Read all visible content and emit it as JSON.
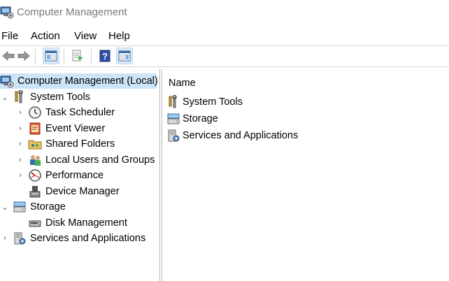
{
  "window": {
    "title": "Computer Management"
  },
  "menu": [
    "File",
    "Action",
    "View",
    "Help"
  ],
  "toolbar": {
    "buttons": [
      "back",
      "forward",
      "show-hide-console-tree",
      "export-list",
      "help",
      "show-hide-action-pane"
    ]
  },
  "tree": {
    "root": "Computer Management (Local)",
    "system_tools": "System Tools",
    "task_scheduler": "Task Scheduler",
    "event_viewer": "Event Viewer",
    "shared_folders": "Shared Folders",
    "local_users": "Local Users and Groups",
    "performance": "Performance",
    "device_manager": "Device Manager",
    "storage": "Storage",
    "disk_management": "Disk Management",
    "services_apps": "Services and Applications"
  },
  "list": {
    "header": "Name",
    "items": [
      "System Tools",
      "Storage",
      "Services and Applications"
    ]
  },
  "colors": {
    "selection": "#cce4f7",
    "toolbar_highlight": "#dbe9f8",
    "title_text": "#7a7a7a"
  }
}
